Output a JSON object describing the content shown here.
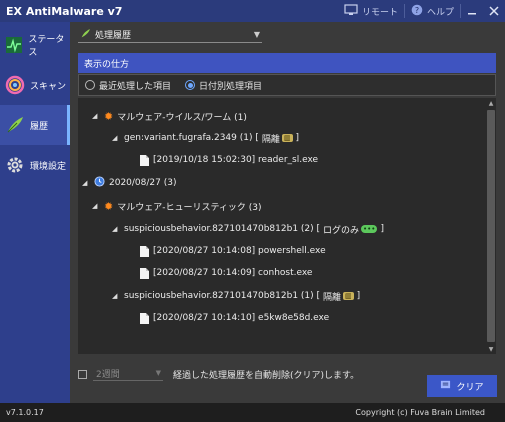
{
  "app": {
    "title": "EX AntiMalware v7"
  },
  "titlebar": {
    "remote_label": "リモート",
    "help_label": "ヘルプ"
  },
  "sidebar": {
    "items": [
      {
        "label": "ステータス",
        "icon": "status-icon"
      },
      {
        "label": "スキャン",
        "icon": "scan-icon"
      },
      {
        "label": "履歴",
        "icon": "history-icon",
        "active": true
      },
      {
        "label": "環境設定",
        "icon": "settings-gear-icon"
      }
    ]
  },
  "history_dropdown": {
    "selected": "処理履歴"
  },
  "view_mode": {
    "title": "表示の仕方",
    "options": [
      {
        "label": "最近処理した項目",
        "selected": false
      },
      {
        "label": "日付別処理項目",
        "selected": true
      }
    ]
  },
  "tree": [
    {
      "text": "マルウェア-ウイルス/ワーム (1)"
    },
    {
      "text": "gen:variant.fugrafa.2349 (1) [",
      "tag": "隔離",
      "close": "]"
    },
    {
      "text": "[2019/10/18 15:02:30] reader_sl.exe"
    },
    {
      "text": "2020/08/27 (3)"
    },
    {
      "text": "マルウェア-ヒューリスティック (3)"
    },
    {
      "text": "suspiciousbehavior.827101470b812b1 (2) [",
      "tag": "ログのみ",
      "close": "]"
    },
    {
      "text": "[2020/08/27 10:14:08] powershell.exe"
    },
    {
      "text": "[2020/08/27 10:14:09] conhost.exe"
    },
    {
      "text": "suspiciousbehavior.827101470b812b1 (1) [",
      "tag": "隔離",
      "close": "]"
    },
    {
      "text": "[2020/08/27 10:14:10] e5kw8e58d.exe"
    }
  ],
  "auto_delete": {
    "checked": false,
    "period": "2週間",
    "text": "経過した処理履歴を自動削除(クリア)します。"
  },
  "clear_button": {
    "label": "クリア"
  },
  "footer": {
    "version": "v7.1.0.17",
    "copyright": "Copyright (c) Fuva Brain Limited"
  },
  "colors": {
    "accent": "#3f54c0",
    "sidebar": "#2e3f8c",
    "titlebar": "#2b3b7c"
  }
}
